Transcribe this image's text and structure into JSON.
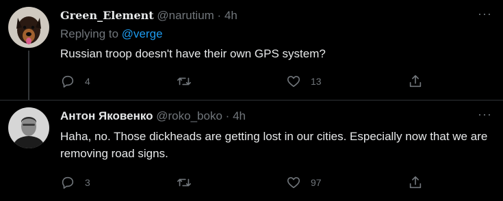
{
  "tweets": [
    {
      "name": "Green_Element",
      "handle": "@narutium",
      "separator": "·",
      "time": "4h",
      "replying_prefix": "Replying to",
      "replying_handle": "@verge",
      "text": "Russian troop doesn't have their own GPS system?",
      "reply_count": "4",
      "retweet_count": "",
      "like_count": "13",
      "avatar_icon": "dog-avatar"
    },
    {
      "name": "Антон Яковенко",
      "handle": "@roko_boko",
      "separator": "·",
      "time": "4h",
      "text": "Haha, no. Those dickheads are getting lost in our cities. Especially now that we are removing road signs.",
      "reply_count": "3",
      "retweet_count": "",
      "like_count": "97",
      "avatar_icon": "person-avatar"
    }
  ],
  "more_glyph": "···",
  "colors": {
    "background": "#000000",
    "text": "#e7e9ea",
    "secondary": "#71767b",
    "link": "#1d9bf0",
    "divider": "#2f3336"
  }
}
